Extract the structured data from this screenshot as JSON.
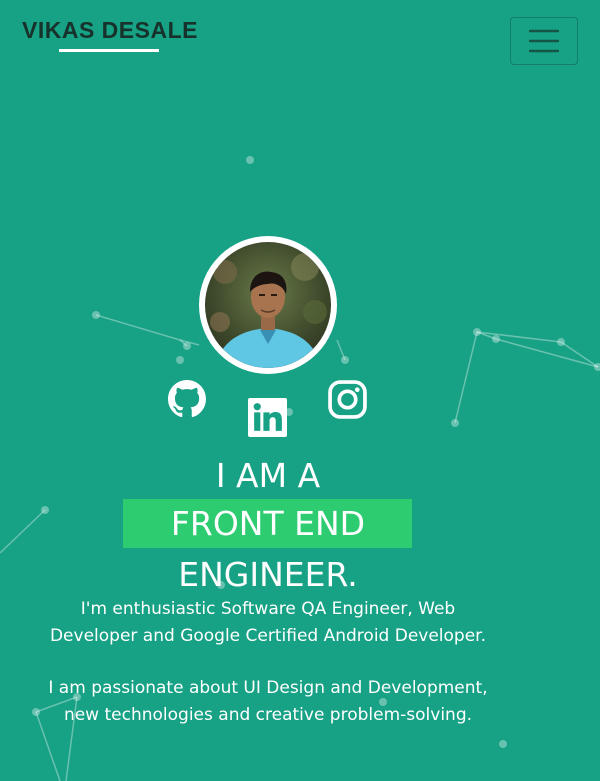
{
  "header": {
    "brand": "VIKAS DESALE",
    "menu_icon": "hamburger-menu-icon"
  },
  "profile": {
    "avatar_icon": "profile-photo"
  },
  "social": {
    "github_icon": "github-icon",
    "linkedin_icon": "linkedin-icon",
    "instagram_icon": "instagram-icon"
  },
  "hero": {
    "line1": "I AM A",
    "highlight": "FRONT END",
    "line3": "ENGINEER.",
    "paragraph1": "I'm enthusiastic Software QA Engineer, Web Developer and Google Certified Android Developer.",
    "paragraph2": "I am passionate about UI Design and Development, new technologies and creative problem-solving."
  },
  "colors": {
    "background": "#17a185",
    "highlight": "#2ecc71",
    "brand_text": "#16322b",
    "text": "#ffffff"
  }
}
